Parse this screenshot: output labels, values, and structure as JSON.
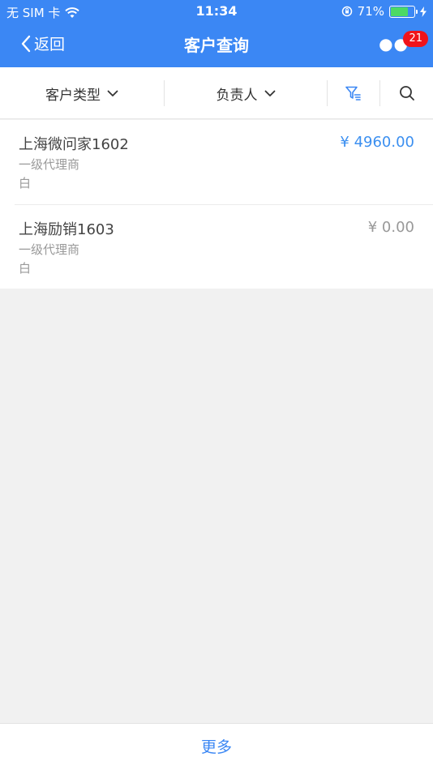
{
  "status_bar": {
    "carrier": "无 SIM 卡",
    "time": "11:34",
    "battery": "71%",
    "battery_level": 0.71
  },
  "nav": {
    "back_label": "返回",
    "title": "客户查询",
    "badge_count": "21"
  },
  "filters": {
    "customer_type": "客户类型",
    "owner": "负责人"
  },
  "customers": [
    {
      "name": "上海微问家1602",
      "amount": "¥  4960.00",
      "type": "一级代理商",
      "level": "白",
      "amount_color": "#3b8ff0"
    },
    {
      "name": "上海励销1603",
      "amount": "¥  0.00",
      "type": "一级代理商",
      "level": "白",
      "amount_color": "#999999"
    }
  ],
  "footer": {
    "more_label": "更多"
  },
  "colors": {
    "accent": "#3b87f4",
    "badge": "#f0131a"
  }
}
